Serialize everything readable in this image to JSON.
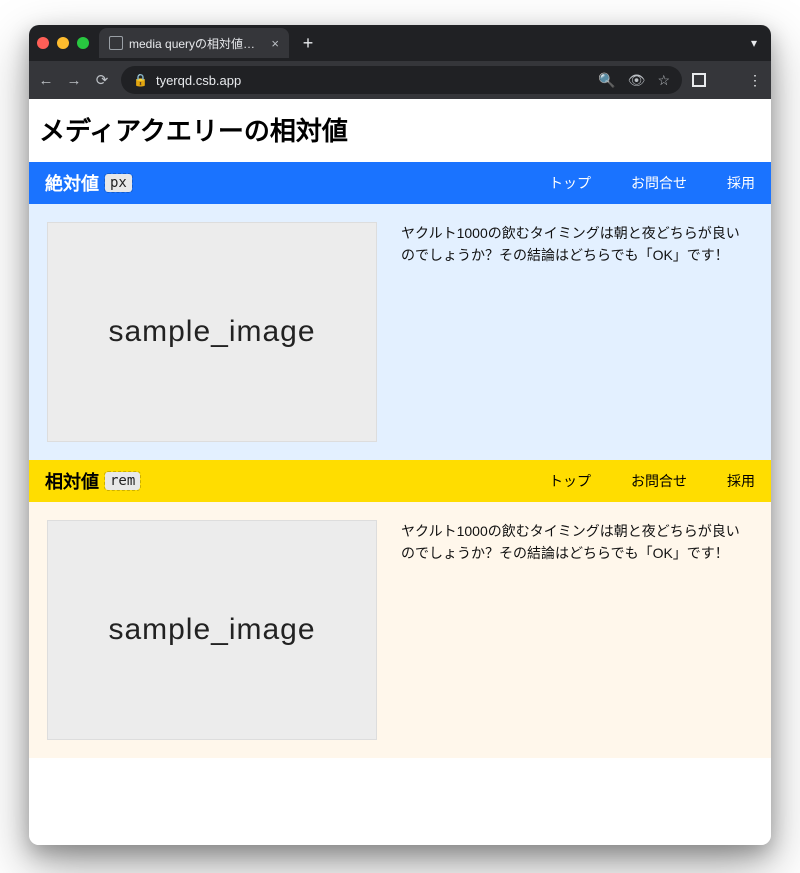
{
  "browser": {
    "tab_title": "media queryの相対値実装サンプ",
    "url": "tyerqd.csb.app"
  },
  "page": {
    "title": "メディアクエリーの相対値"
  },
  "nav": {
    "top": "トップ",
    "contact": "お問合せ",
    "recruit": "採用"
  },
  "sections": {
    "abs": {
      "label": "絶対値",
      "unit": "px",
      "image_text": "sample_image",
      "body": "ヤクルト1000の飲むタイミングは朝と夜どちらが良いのでしょうか？その結論はどちらでも「OK」です！"
    },
    "rel": {
      "label": "相対値",
      "unit": "rem",
      "image_text": "sample_image",
      "body": "ヤクルト1000の飲むタイミングは朝と夜どちらが良いのでしょうか？その結論はどちらでも「OK」です！"
    }
  }
}
